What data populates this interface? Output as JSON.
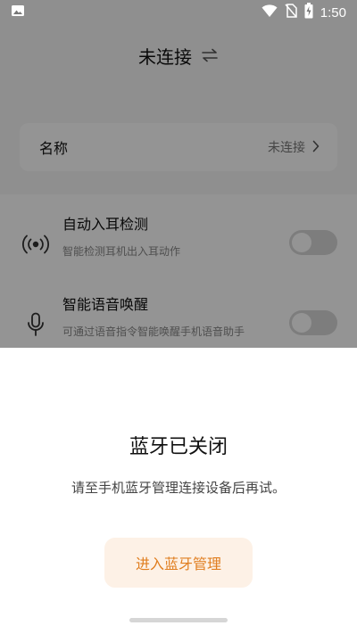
{
  "status_bar": {
    "time": "1:50",
    "icons": [
      "image-icon",
      "wifi-icon",
      "no-sim-icon",
      "battery-charging-icon"
    ]
  },
  "header": {
    "title": "未连接",
    "swap_icon": "swap-arrows-icon"
  },
  "name_card": {
    "label": "名称",
    "value": "未连接",
    "chevron_icon": "chevron-right-icon"
  },
  "settings": [
    {
      "icon": "in-ear-detect-icon",
      "title": "自动入耳检测",
      "description": "智能检测耳机出入耳动作",
      "enabled": false
    },
    {
      "icon": "microphone-icon",
      "title": "智能语音唤醒",
      "description": "可通过语音指令智能唤醒手机语音助手",
      "enabled": false
    }
  ],
  "dialog": {
    "title": "蓝牙已关闭",
    "description": "请至手机蓝牙管理连接设备后再试。",
    "button_label": "进入蓝牙管理"
  },
  "colors": {
    "accent": "#e07d1e",
    "button_bg": "#fdf1e6",
    "overlay": "rgba(0,0,0,0.42)"
  }
}
